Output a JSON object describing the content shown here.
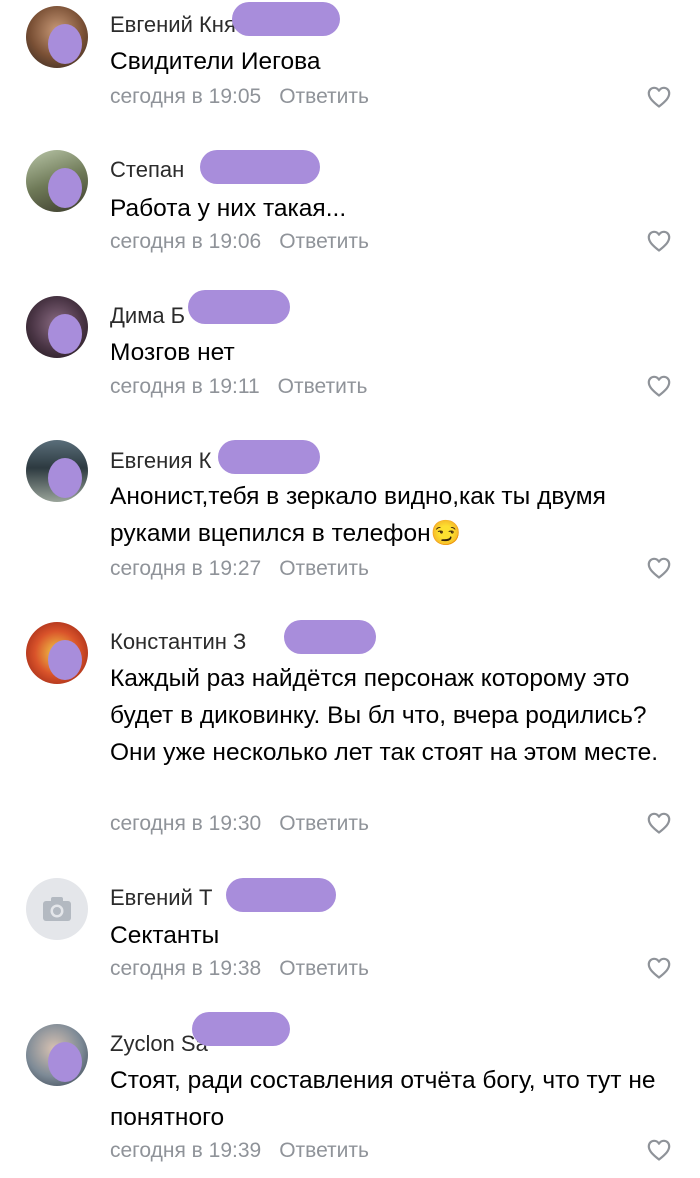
{
  "comments": [
    {
      "author": "Евгений Князев",
      "text": "Свидители Иегова",
      "time": "сегодня в 19:05",
      "reply": "Ответить"
    },
    {
      "author": "Степан",
      "text": "Работа у них такая...",
      "time": "сегодня в 19:06",
      "reply": "Ответить"
    },
    {
      "author": "Дима Б",
      "text": "Мозгов нет",
      "time": "сегодня в 19:11",
      "reply": "Ответить"
    },
    {
      "author": "Евгения К",
      "text": "Анонист,тебя в зеркало видно,как ты двумя руками вцепился в телефон😏",
      "time": "сегодня в 19:27",
      "reply": "Ответить"
    },
    {
      "author": "Константин З",
      "text": "Каждый раз найдётся персонаж которому это будет в диковинку. Вы бл что, вчера родились? Они уже несколько лет так стоят на этом месте.",
      "time": "сегодня в 19:30",
      "reply": "Ответить"
    },
    {
      "author": "Евгений Т",
      "text": "Сектанты",
      "time": "сегодня в 19:38",
      "reply": "Ответить"
    },
    {
      "author": "Zyclon Sa",
      "text": "Стоят, ради составления отчёта богу, что тут не понятного",
      "time": "сегодня в 19:39",
      "reply": "Ответить"
    }
  ],
  "icons": {
    "like": "heart-outline-icon",
    "avatar_placeholder": "camera-icon"
  },
  "colors": {
    "meta": "#8f9399",
    "redaction": "#a88ddb"
  }
}
